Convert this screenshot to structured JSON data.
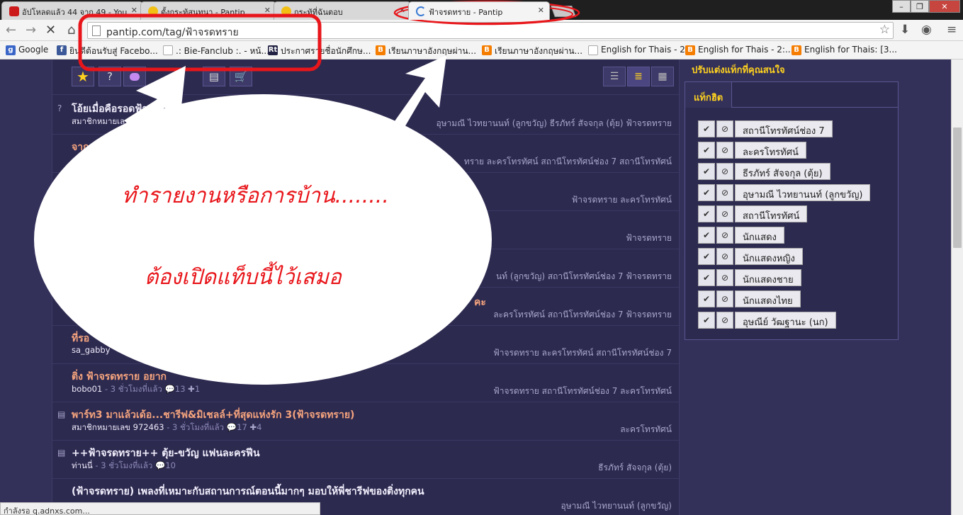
{
  "tabs": [
    {
      "title": "อัปโหลดแล้ว 44 จาก 49 - You",
      "icon": "youtube-icon",
      "color": "#cc1a1a"
    },
    {
      "title": "ตั้งกระทู้สนทนา - Pantip",
      "icon": "smiley-icon",
      "color": "#f2c014"
    },
    {
      "title": "กระทู้ที่ฉันตอบ",
      "icon": "smiley-icon",
      "color": "#f2c014"
    },
    {
      "title": "ฟ้าจรดทราย - Pantip",
      "icon": "loading-icon",
      "color": "#3a7bd5"
    }
  ],
  "address": {
    "url": "pantip.com/tag/ฟ้าจรดทราย"
  },
  "bookmarks": [
    {
      "label": "Google",
      "icon": "g",
      "color": "#3a66c8"
    },
    {
      "label": "ยินดีต้อนรับสู่ Facebo...",
      "icon": "f",
      "color": "#3b5998"
    },
    {
      "label": ".: Bie-Fanclub :. - หน้...",
      "icon": "",
      "color": "#aaaaaa"
    },
    {
      "label": "ประกาศรายชื่อนักศึกษ...",
      "icon": "Rt",
      "color": "#222244"
    },
    {
      "label": "เรียนภาษาอังกฤษผ่าน...",
      "icon": "B",
      "color": "#f57d00"
    },
    {
      "label": "เรียนภาษาอังกฤษผ่าน...",
      "icon": "B",
      "color": "#f57d00"
    },
    {
      "label": "English for Thais - 2",
      "icon": "",
      "color": "#aaaaaa"
    },
    {
      "label": "English for Thais - 2:...",
      "icon": "B",
      "color": "#f57d00"
    },
    {
      "label": "English for Thais: [3...",
      "icon": "B",
      "color": "#f57d00"
    }
  ],
  "window": {
    "minimize": "–",
    "maximize": "❐",
    "close": "✕"
  },
  "filters": [
    "★",
    "?",
    "💬",
    "",
    "",
    "▤",
    "🛒"
  ],
  "posts": [
    {
      "title": "โอ้ยเมื่อคือรอดฟ้า",
      "author": "สมาชิกหมายเลข",
      "ago": "",
      "comments": "",
      "votes": "",
      "tags": "อุษามณี ไวทยานนท์ (ลูกขวัญ)  ธีรภัทร์ สัจจกุล (ตุ้ย)  ฟ้าจรดทราย",
      "icon": "?"
    },
    {
      "title": "จาก",
      "author": "",
      "ago": "",
      "comments": "",
      "votes": "",
      "tags": "ทราย  ละครโทรทัศน์  สถานีโทรทัศน์ช่อง 7  สถานีโทรทัศน์",
      "icon": ""
    },
    {
      "title": "",
      "author": "",
      "ago": "",
      "comments": "",
      "votes": "",
      "tags": "ฟ้าจรดทราย  ละครโทรทัศน์",
      "icon": ""
    },
    {
      "title": "",
      "author": "",
      "ago": "",
      "comments": "",
      "votes": "",
      "tags": "ฟ้าจรดทราย",
      "icon": ""
    },
    {
      "title": "",
      "author": "",
      "ago": "",
      "comments": "",
      "votes": "",
      "tags": "นท์ (ลูกขวัญ)  สถานีโทรทัศน์ช่อง 7  ฟ้าจรดทราย",
      "icon": ""
    },
    {
      "title": "คะ",
      "author": "",
      "ago": "",
      "comments": "",
      "votes": "",
      "tags": "ละครโทรทัศน์  สถานีโทรทัศน์ช่อง 7  ฟ้าจรดทราย",
      "icon": ""
    },
    {
      "title": "ที่รอ",
      "author": "sa_gabby",
      "ago": "",
      "comments": "",
      "votes": "",
      "tags": "ฟ้าจรดทราย  ละครโทรทัศน์  สถานีโทรทัศน์ช่อง 7",
      "icon": ""
    },
    {
      "title": "ติ่ง ฟ้าจรดทราย อยาก",
      "author": "bobo01",
      "ago": " - 3 ชั่วโมงที่แล้ว",
      "comments": "13",
      "votes": "1",
      "tags": "ฟ้าจรดทราย  สถานีโทรทัศน์ช่อง 7  ละครโทรทัศน์",
      "icon": ""
    },
    {
      "title": "พาร์ท3 มาแล้วเด้อ...ชารีฟ&มิเชลล์+ที่สุดแห่งรัก 3(ฟ้าจรดทราย)",
      "author": "สมาชิกหมายเลข 972463",
      "ago": " - 3 ชั่วโมงที่แล้ว",
      "comments": "17",
      "votes": "4",
      "tags": "ละครโทรทัศน์",
      "icon": "▤"
    },
    {
      "title": "++ฟ้าจรดทราย++ ตุ้ย-ขวัญ แฟนละครฟีน",
      "author": "ท่านนี่",
      "ago": " - 3 ชั่วโมงที่แล้ว",
      "comments": "10",
      "votes": "",
      "tags": "ธีรภัทร์ สัจจกุล (ตุ้ย)",
      "icon": "▤"
    },
    {
      "title": "(ฟ้าจรดทราย) เพลงที่เหมาะกับสถานการณ์ตอนนี้มากๆ มอบให้พี่ชารีฟของติ่งทุกคน",
      "author": "",
      "ago": "",
      "comments": "",
      "votes": "",
      "tags": "อุษามณี ไวทยานนท์ (ลูกขวัญ)",
      "icon": ""
    }
  ],
  "status": "กำลังรอ q.adnxs.com...",
  "sidebar": {
    "heading": "ปรับแต่งแท็กที่คุณสนใจ",
    "tab": "แท็กฮิต",
    "tags": [
      "สถานีโทรทัศน์ช่อง 7",
      "ละครโทรทัศน์",
      "ธีรภัทร์ สัจจกุล (ตุ้ย)",
      "อุษามณี ไวทยานนท์ (ลูกขวัญ)",
      "สถานีโทรทัศน์",
      "นักแสดง",
      "นักแสดงหญิง",
      "นักแสดงชาย",
      "นักแสดงไทย",
      "อุษณีย์ วัฒฐานะ (นก)"
    ]
  },
  "annotation": {
    "line1": "ทำรายงานหรือการบ้าน........",
    "line2": "ต้องเปิดแท็บนี้ไว้เสมอ",
    "color": "#e8161b"
  }
}
